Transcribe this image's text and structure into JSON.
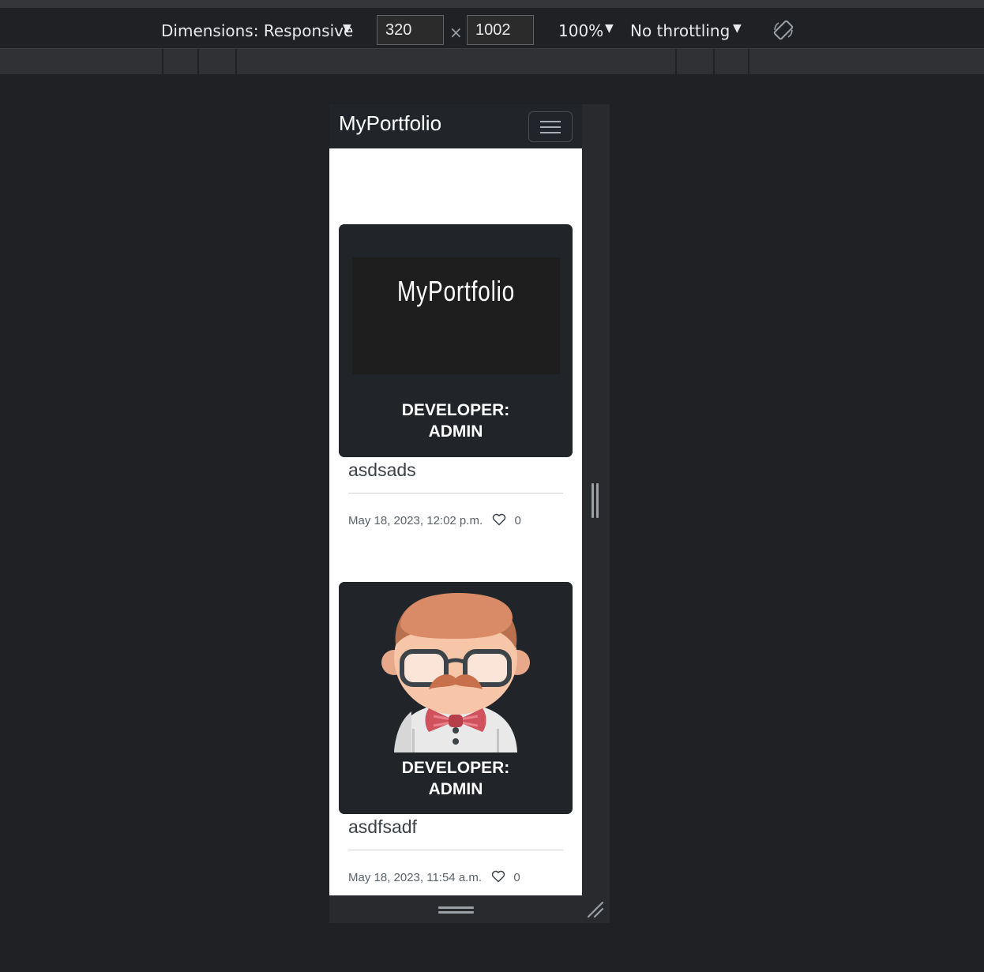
{
  "toolbar": {
    "dimensions_label": "Dimensions: Responsive",
    "width_value": "320",
    "times": "×",
    "height_value": "1002",
    "zoom_label": "100%",
    "throttling_label": "No throttling",
    "rotate_icon": "rotate-icon"
  },
  "navbar": {
    "brand": "MyPortfolio",
    "toggler_icon": "hamburger-icon"
  },
  "posts": [
    {
      "image_text": "MyPortfolio",
      "developer_line1": "DEVELOPER:",
      "developer_line2": "ADMIN",
      "title": "asdsads",
      "date": "May 18, 2023, 12:02 p.m.",
      "likes": "0"
    },
    {
      "image_alt": "developer-avatar",
      "developer_line1": "DEVELOPER:",
      "developer_line2": "ADMIN",
      "title": "asdfsadf",
      "date": "May 18, 2023, 11:54 a.m.",
      "likes": "0"
    }
  ],
  "colors": {
    "navbar_bg": "#212529",
    "card_bg": "#212529",
    "devtools_bg": "#202124"
  }
}
